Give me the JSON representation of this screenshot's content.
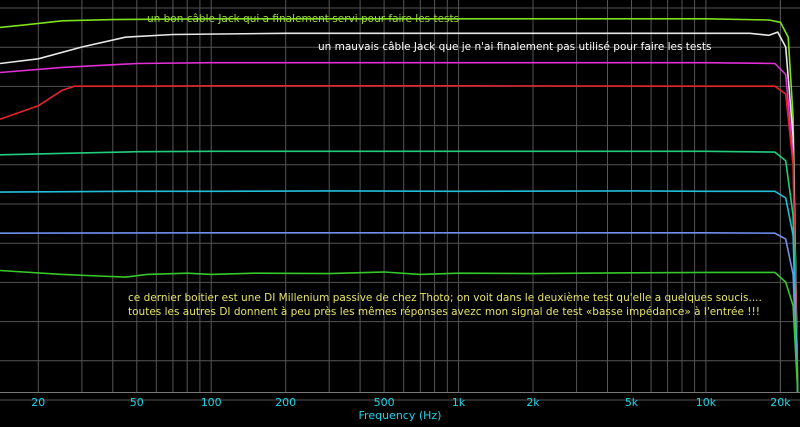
{
  "chart_data": {
    "type": "line",
    "title": "",
    "xlabel": "Frequency (Hz)",
    "ylabel": "",
    "x_scale": "log",
    "xlim": [
      14,
      24000
    ],
    "x_ticks": [
      {
        "value": 20,
        "label": "20"
      },
      {
        "value": 50,
        "label": "50"
      },
      {
        "value": 100,
        "label": "100"
      },
      {
        "value": 200,
        "label": "200"
      },
      {
        "value": 500,
        "label": "500"
      },
      {
        "value": 1000,
        "label": "1k"
      },
      {
        "value": 2000,
        "label": "2k"
      },
      {
        "value": 5000,
        "label": "5k"
      },
      {
        "value": 10000,
        "label": "10k"
      },
      {
        "value": 20000,
        "label": "20k"
      }
    ],
    "y_ticks_shown": false,
    "grid": true,
    "background": "#000000",
    "grid_color": "#555555",
    "tick_label_color": "#22d3e6",
    "series": [
      {
        "color": "#7fe01c",
        "points": [
          [
            14,
            0.93
          ],
          [
            18,
            0.937
          ],
          [
            25,
            0.947
          ],
          [
            40,
            0.95
          ],
          [
            100,
            0.952
          ],
          [
            1000,
            0.952
          ],
          [
            10000,
            0.952
          ],
          [
            18000,
            0.949
          ],
          [
            20000,
            0.943
          ],
          [
            21500,
            0.905
          ],
          [
            22500,
            0.7
          ],
          [
            23500,
            0.0
          ]
        ]
      },
      {
        "color": "#e8e8e8",
        "points": [
          [
            14,
            0.838
          ],
          [
            20,
            0.85
          ],
          [
            30,
            0.88
          ],
          [
            45,
            0.905
          ],
          [
            70,
            0.912
          ],
          [
            200,
            0.915
          ],
          [
            1000,
            0.915
          ],
          [
            5000,
            0.915
          ],
          [
            10000,
            0.915
          ],
          [
            15000,
            0.915
          ],
          [
            18000,
            0.91
          ],
          [
            19500,
            0.918
          ],
          [
            21000,
            0.88
          ],
          [
            22500,
            0.65
          ],
          [
            23500,
            0.0
          ]
        ]
      },
      {
        "color": "#e12ed6",
        "points": [
          [
            14,
            0.815
          ],
          [
            25,
            0.828
          ],
          [
            50,
            0.838
          ],
          [
            100,
            0.84
          ],
          [
            1000,
            0.84
          ],
          [
            10000,
            0.84
          ],
          [
            19000,
            0.838
          ],
          [
            21000,
            0.81
          ],
          [
            22500,
            0.6
          ],
          [
            23500,
            0.0
          ]
        ]
      },
      {
        "color": "#e5232a",
        "points": [
          [
            14,
            0.696
          ],
          [
            20,
            0.73
          ],
          [
            25,
            0.77
          ],
          [
            28,
            0.78
          ],
          [
            50,
            0.78
          ],
          [
            100,
            0.781
          ],
          [
            1000,
            0.781
          ],
          [
            10000,
            0.78
          ],
          [
            19000,
            0.78
          ],
          [
            21000,
            0.76
          ],
          [
            22500,
            0.58
          ],
          [
            23500,
            0.0
          ]
        ]
      },
      {
        "color": "#22cd7e",
        "points": [
          [
            14,
            0.605
          ],
          [
            30,
            0.61
          ],
          [
            50,
            0.613
          ],
          [
            100,
            0.614
          ],
          [
            1000,
            0.614
          ],
          [
            10000,
            0.614
          ],
          [
            19000,
            0.612
          ],
          [
            21000,
            0.59
          ],
          [
            22500,
            0.45
          ],
          [
            23500,
            0.0
          ]
        ]
      },
      {
        "color": "#22bfd9",
        "points": [
          [
            14,
            0.51
          ],
          [
            50,
            0.512
          ],
          [
            100,
            0.512
          ],
          [
            300,
            0.513
          ],
          [
            1000,
            0.512
          ],
          [
            5000,
            0.513
          ],
          [
            10000,
            0.512
          ],
          [
            19000,
            0.512
          ],
          [
            21000,
            0.495
          ],
          [
            22500,
            0.4
          ],
          [
            23500,
            0.0
          ]
        ]
      },
      {
        "color": "#6f90f0",
        "points": [
          [
            14,
            0.405
          ],
          [
            100,
            0.406
          ],
          [
            1000,
            0.406
          ],
          [
            10000,
            0.406
          ],
          [
            19000,
            0.405
          ],
          [
            21000,
            0.39
          ],
          [
            22500,
            0.3
          ],
          [
            23500,
            0.0
          ]
        ]
      },
      {
        "color": "#36c82a",
        "points": [
          [
            14,
            0.31
          ],
          [
            25,
            0.3
          ],
          [
            35,
            0.296
          ],
          [
            45,
            0.293
          ],
          [
            55,
            0.3
          ],
          [
            80,
            0.303
          ],
          [
            100,
            0.3
          ],
          [
            150,
            0.303
          ],
          [
            300,
            0.302
          ],
          [
            500,
            0.306
          ],
          [
            700,
            0.3
          ],
          [
            1000,
            0.303
          ],
          [
            2000,
            0.302
          ],
          [
            5000,
            0.304
          ],
          [
            10000,
            0.305
          ],
          [
            19000,
            0.305
          ],
          [
            21000,
            0.28
          ],
          [
            22500,
            0.22
          ],
          [
            23500,
            0.0
          ]
        ]
      }
    ]
  },
  "annotations": {
    "good_cable": "un bon câble Jack qui a finalement servi pour faire les tests",
    "bad_cable": "un mauvais câble Jack que je n'ai finalement pas utilisé pour faire les tests",
    "di_line1": "ce dernier boitier est une DI Millenium passive de chez Thoto; on voit dans le deuxième test qu'elle a quelques soucis....",
    "di_line2": "toutes les autres DI donnent à peu près les mêmes réponses avezc mon signal de test «basse impédance» à l'entrée !!!"
  }
}
